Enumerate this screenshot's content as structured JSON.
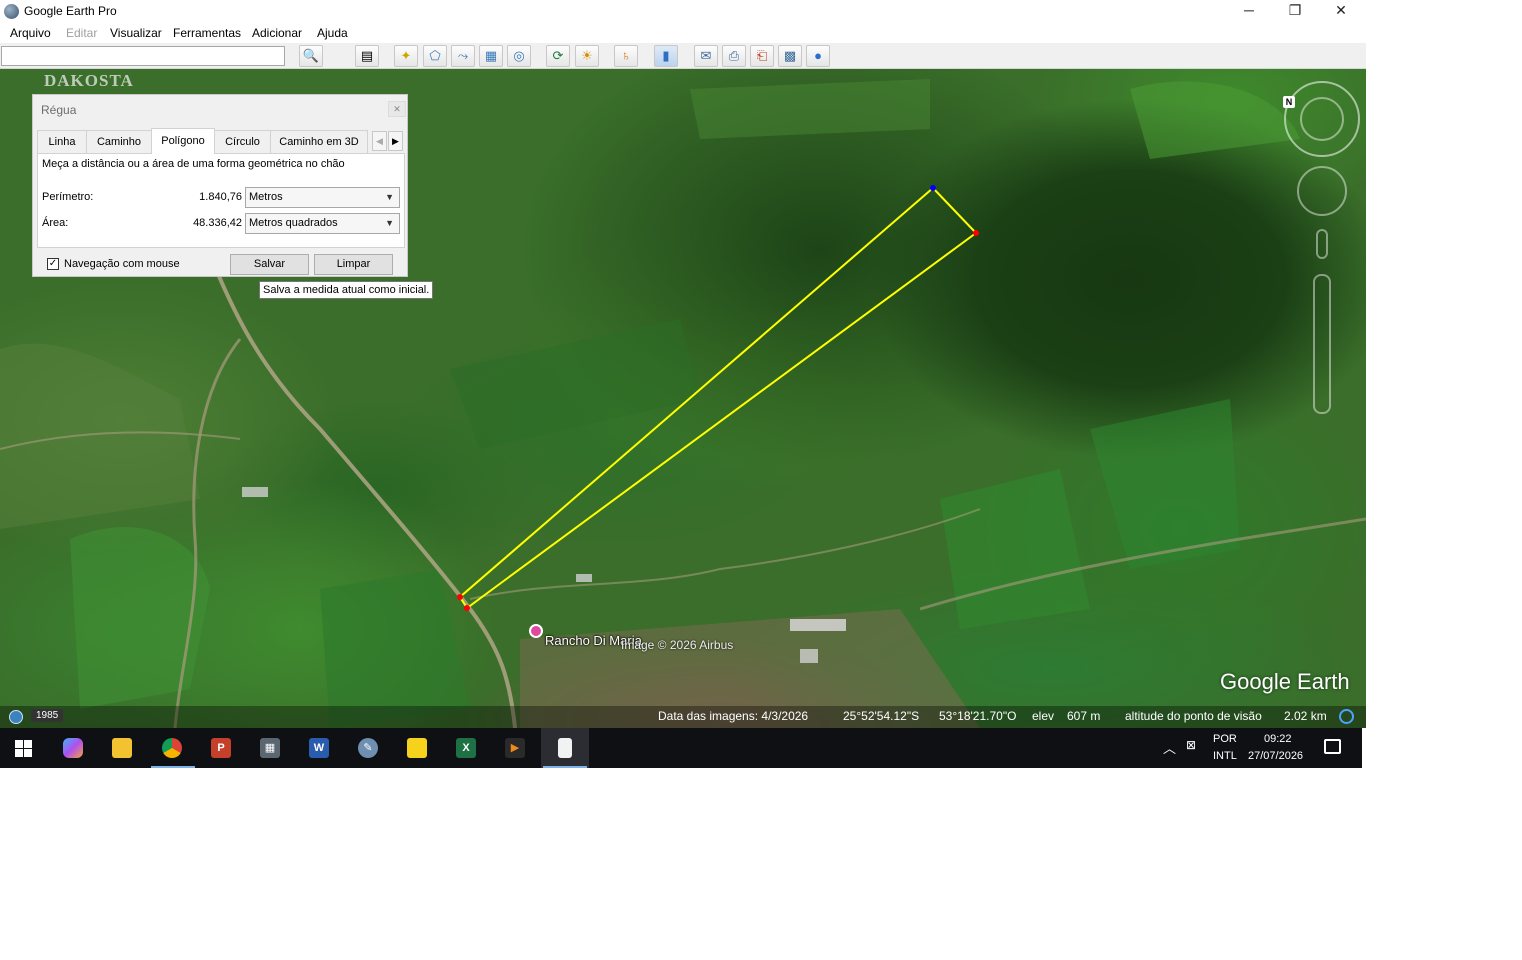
{
  "window": {
    "title": "Google Earth Pro",
    "controls": {
      "minimize": "─",
      "maximize": "❐",
      "close": "✕"
    }
  },
  "menu": {
    "items": [
      "Arquivo",
      "Editar",
      "Visualizar",
      "Ferramentas",
      "Adicionar",
      "Ajuda"
    ],
    "disabled": [
      "Editar"
    ]
  },
  "toolbar": {
    "search_value": "",
    "buttons": [
      {
        "name": "search-button",
        "icon": "🔍"
      },
      {
        "name": "sidebar-button",
        "icon": "▤"
      },
      {
        "name": "placemark-button",
        "icon": "✦"
      },
      {
        "name": "polygon-button",
        "icon": "⬠"
      },
      {
        "name": "path-button",
        "icon": "⤳"
      },
      {
        "name": "overlay-button",
        "icon": "▦"
      },
      {
        "name": "record-tour-button",
        "icon": "◎"
      },
      {
        "name": "historical-imagery-button",
        "icon": "⟳"
      },
      {
        "name": "sunlight-button",
        "icon": "☀"
      },
      {
        "name": "planets-button",
        "icon": "♄"
      },
      {
        "name": "ruler-button",
        "icon": "▮"
      },
      {
        "name": "email-button",
        "icon": "✉"
      },
      {
        "name": "print-button",
        "icon": "⎙"
      },
      {
        "name": "save-image-button",
        "icon": "⎗"
      },
      {
        "name": "view-maps-button",
        "icon": "▩"
      },
      {
        "name": "sign-in-button",
        "icon": "●"
      }
    ]
  },
  "map": {
    "watermark": "DAKOSTA",
    "place_label": "Rancho Di Maria",
    "credit": "Image © 2026 Airbus",
    "logo": "Google Earth",
    "north_label": "N"
  },
  "status": {
    "historical_year": "1985",
    "imagery_date": "Data das imagens: 4/3/2026",
    "latitude": "25°52'54.12\"S",
    "longitude": "53°18'21.70\"O",
    "elev_label": "elev",
    "elev_value": "607 m",
    "eye_alt_label": "altitude do ponto de visão",
    "eye_alt_value": "2.02 km"
  },
  "ruler": {
    "title": "Régua",
    "tabs": [
      "Linha",
      "Caminho",
      "Polígono",
      "Círculo",
      "Caminho em 3D"
    ],
    "active_tab": "Polígono",
    "description": "Meça a distância ou a área de uma forma geométrica no chão",
    "perimeter_label": "Perímetro:",
    "perimeter_value": "1.840,76",
    "perimeter_unit": "Metros",
    "area_label": "Área:",
    "area_value": "48.336,42",
    "area_unit": "Metros quadrados",
    "mouse_nav_label": "Navegação com mouse",
    "mouse_nav_checked": true,
    "save_label": "Salvar",
    "clear_label": "Limpar",
    "tooltip": "Salva a medida atual como inicial."
  },
  "polygon": {
    "color": "#ffff00",
    "vertex_color": "#ff0000",
    "last_vertex_color": "#0000ff"
  },
  "taskbar": {
    "apps": [
      {
        "name": "copilot",
        "label": "",
        "color": "#8a5cf5",
        "running": false
      },
      {
        "name": "file-explorer",
        "label": "",
        "color": "#f2c230",
        "running": false
      },
      {
        "name": "chrome",
        "label": "",
        "color": "#2e9d49",
        "running": true
      },
      {
        "name": "powerpoint",
        "label": "P",
        "color": "#c4402a",
        "running": false
      },
      {
        "name": "calculator",
        "label": "▦",
        "color": "#5b6770",
        "running": false
      },
      {
        "name": "word",
        "label": "W",
        "color": "#2a5cad",
        "running": false
      },
      {
        "name": "paint",
        "label": "✎",
        "color": "#6e8fb0",
        "running": false
      },
      {
        "name": "sticky-notes",
        "label": "",
        "color": "#f6d21c",
        "running": false
      },
      {
        "name": "excel",
        "label": "X",
        "color": "#1e7145",
        "running": false
      },
      {
        "name": "media-player",
        "label": "▶",
        "color": "#d6751c",
        "running": false
      },
      {
        "name": "google-earth-file",
        "label": "",
        "color": "#f2f2f2",
        "running": true,
        "active": true
      }
    ],
    "language": "POR",
    "layout": "INTL",
    "time": "09:22",
    "date": "27/07/2026"
  }
}
